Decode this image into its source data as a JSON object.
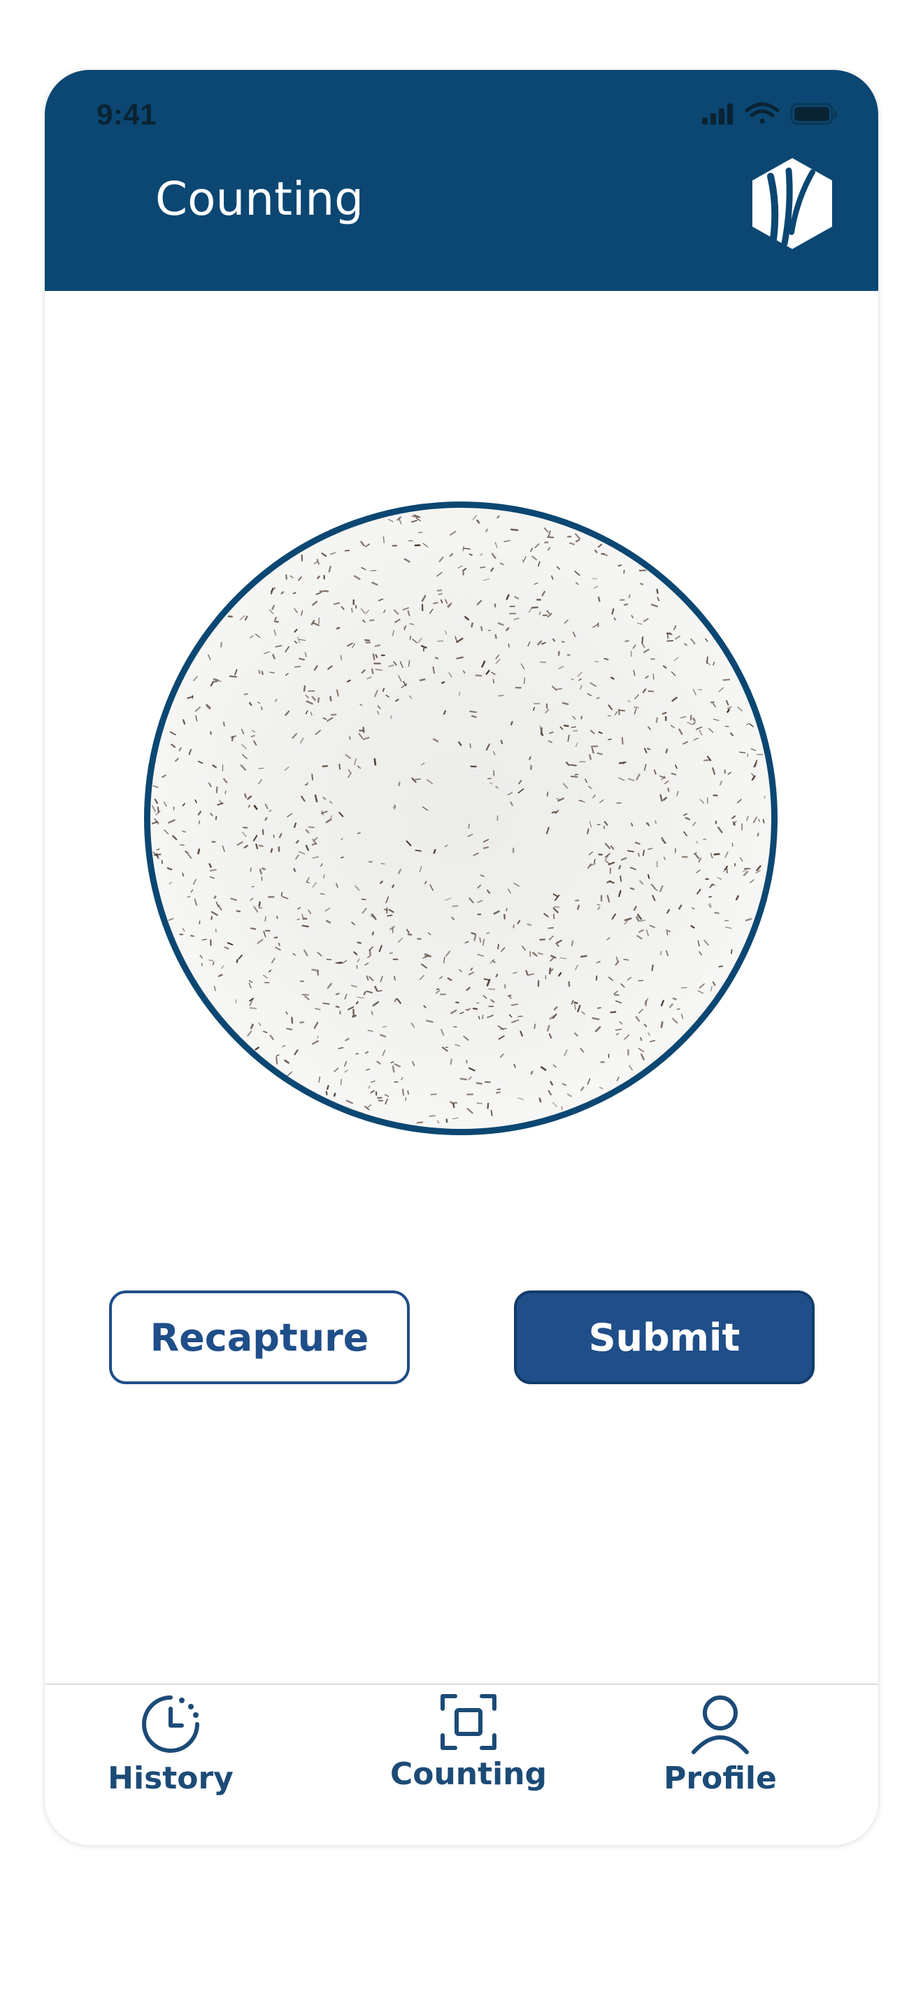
{
  "status_bar": {
    "time": "9:41",
    "icons": [
      "cellular-signal-icon",
      "wifi-icon",
      "battery-icon"
    ]
  },
  "header": {
    "title": "Counting",
    "logo": "app-logo-icon"
  },
  "sample": {
    "image": "captured-petri-dish-image"
  },
  "actions": {
    "recapture_label": "Recapture",
    "submit_label": "Submit"
  },
  "tab_bar": {
    "items": [
      {
        "label": "History",
        "icon": "history-clock-icon"
      },
      {
        "label": "Counting",
        "icon": "scan-frame-icon"
      },
      {
        "label": "Profile",
        "icon": "user-icon"
      }
    ],
    "active_index": 1
  },
  "colors": {
    "header_bg": "#0b4772",
    "primary_button": "#1f4e89",
    "tab_text": "#1c4b77"
  }
}
